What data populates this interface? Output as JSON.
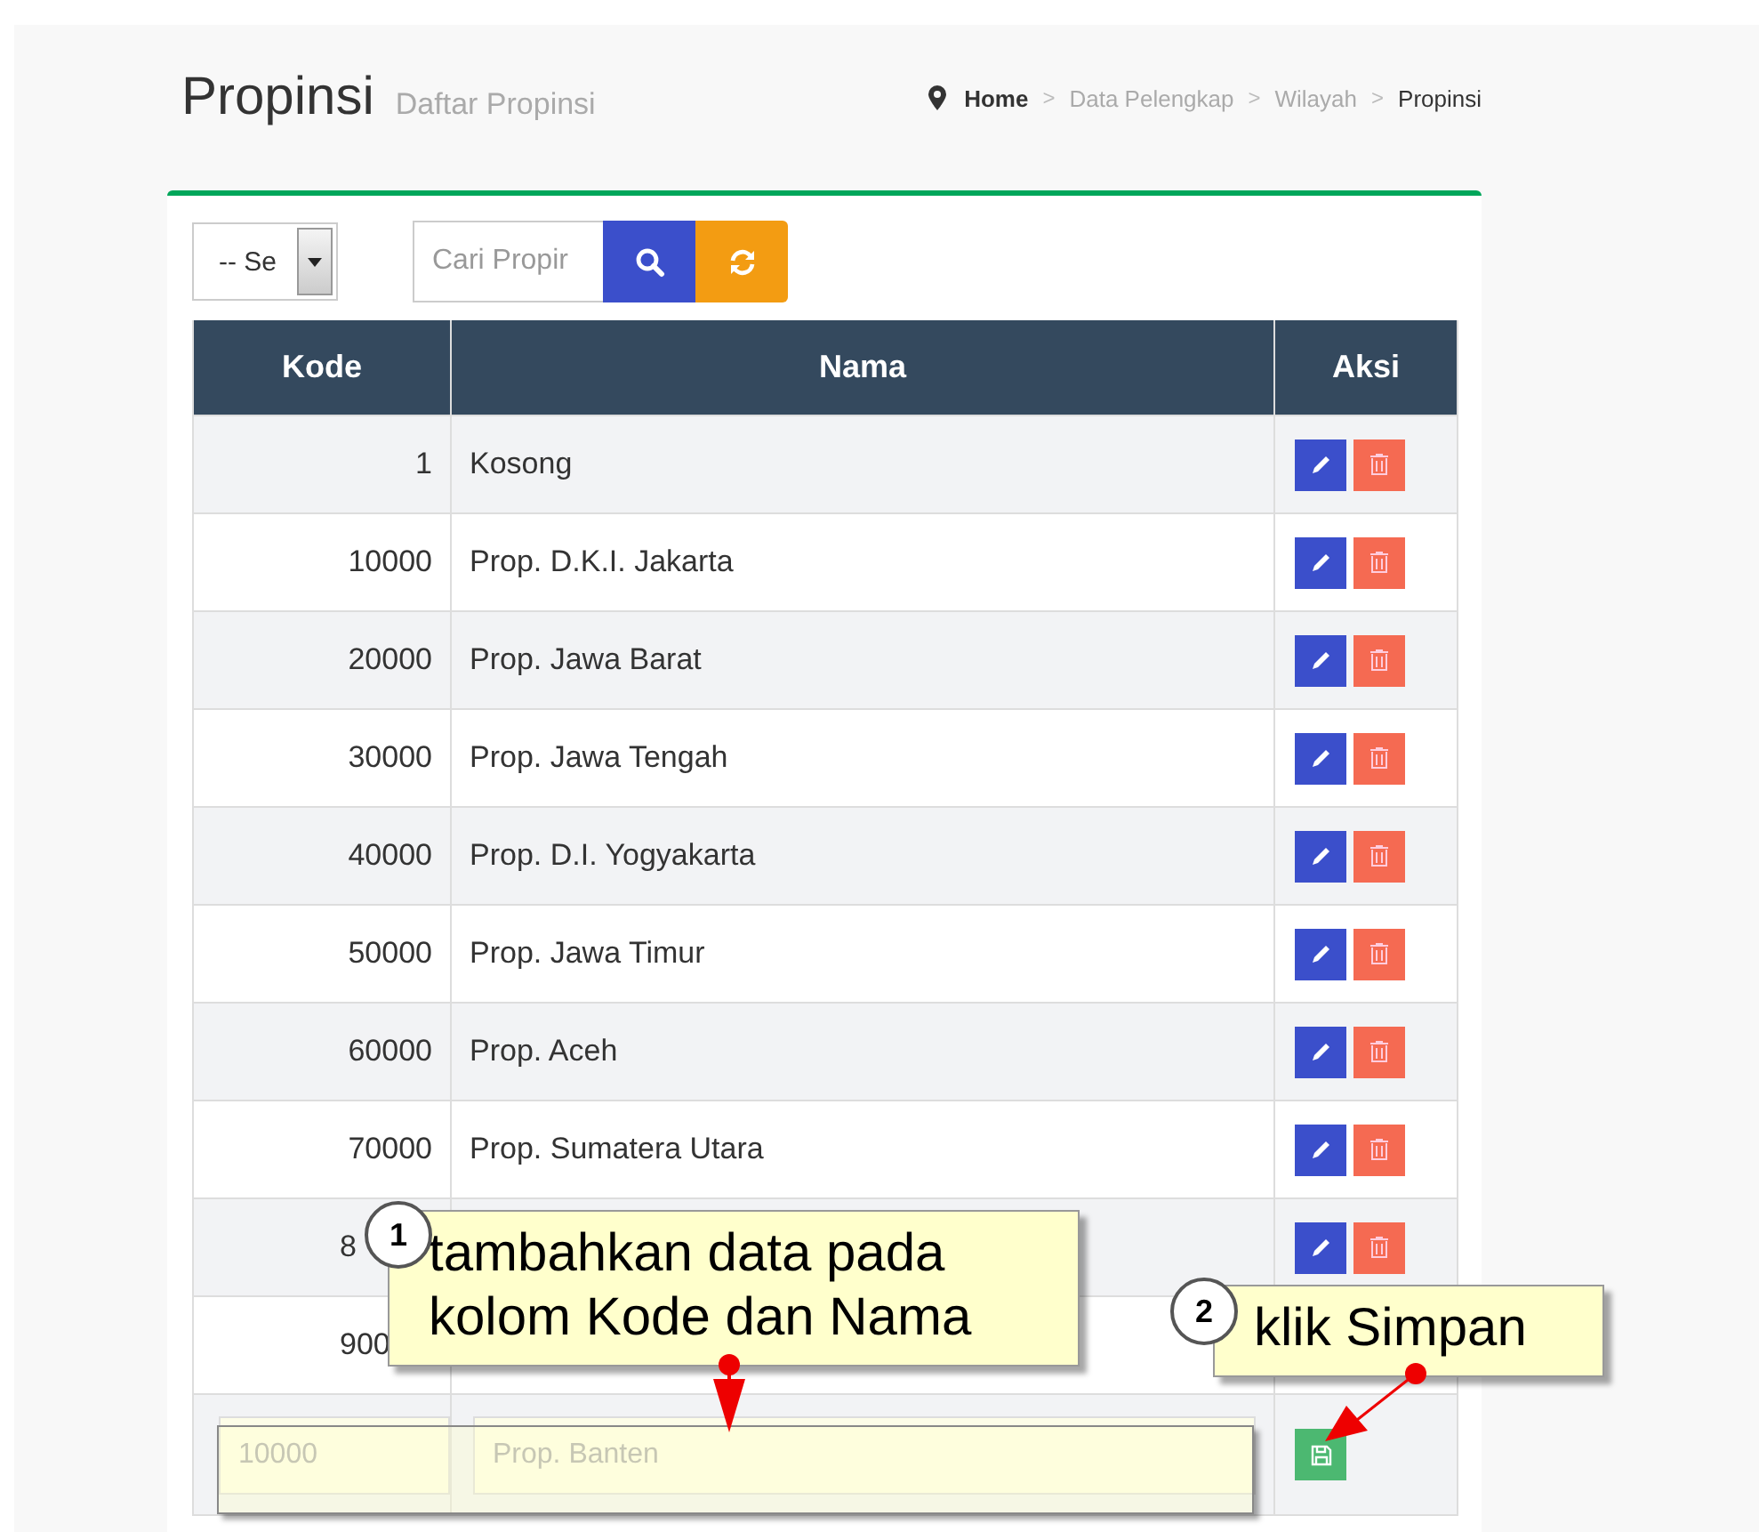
{
  "page": {
    "title": "Propinsi",
    "subtitle": "Daftar Propinsi"
  },
  "breadcrumb": {
    "separator": ">",
    "items": [
      {
        "label": "Home",
        "current": false,
        "home": true
      },
      {
        "label": "Data Pelengkap",
        "current": false,
        "home": false
      },
      {
        "label": "Wilayah",
        "current": false,
        "home": false
      },
      {
        "label": "Propinsi",
        "current": true,
        "home": false
      }
    ]
  },
  "toolbar": {
    "select_value": "-- Se",
    "search_placeholder": "Cari Propir"
  },
  "table": {
    "columns": [
      "Kode",
      "Nama",
      "Aksi"
    ],
    "rows": [
      {
        "code": "1",
        "name": "Kosong"
      },
      {
        "code": "10000",
        "name": "Prop. D.K.I. Jakarta"
      },
      {
        "code": "20000",
        "name": "Prop. Jawa Barat"
      },
      {
        "code": "30000",
        "name": "Prop. Jawa Tengah"
      },
      {
        "code": "40000",
        "name": "Prop. D.I. Yogyakarta"
      },
      {
        "code": "50000",
        "name": "Prop. Jawa Timur"
      },
      {
        "code": "60000",
        "name": "Prop. Aceh"
      },
      {
        "code": "70000",
        "name": "Prop. Sumatera Utara"
      },
      {
        "code": "8",
        "kind": "covered"
      },
      {
        "code": "900",
        "kind": "covered"
      }
    ],
    "new_row": {
      "code_placeholder": "10000",
      "name_placeholder": "Prop. Banten"
    }
  },
  "callouts": [
    {
      "number": "1",
      "text": "tambahkan data pada kolom Kode dan Nama"
    },
    {
      "number": "2",
      "text": "klik Simpan"
    }
  ]
}
